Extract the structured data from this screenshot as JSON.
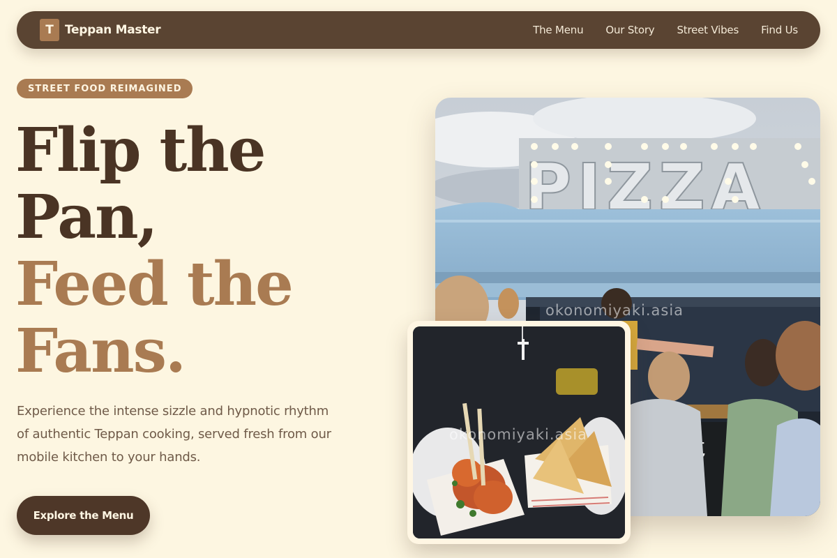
{
  "nav": {
    "logo_letter": "T",
    "brand": "Teppan Master",
    "links": [
      "The Menu",
      "Our Story",
      "Street Vibes",
      "Find Us"
    ]
  },
  "hero": {
    "badge": "STREET FOOD REIMAGINED",
    "headline_line1": "Flip the",
    "headline_line2": "Pan,",
    "headline_line3": "Feed the",
    "headline_line4": "Fans.",
    "lead": "Experience the intense sizzle and hypnotic rhythm of authentic Teppan cooking, served fresh from our mobile kitchen to your hands.",
    "cta": "Explore the Menu"
  },
  "images": {
    "truck_sign": "PIZZA",
    "truck_watermark": "okonomiyaki.asia",
    "chalkboard_text": "erit\noni\ne -",
    "food_watermark": "okonomiyaki.asia"
  },
  "colors": {
    "background": "#fdf6e1",
    "nav": "#5a4432",
    "accent": "#a97b52",
    "dark_text": "#4a3424"
  }
}
